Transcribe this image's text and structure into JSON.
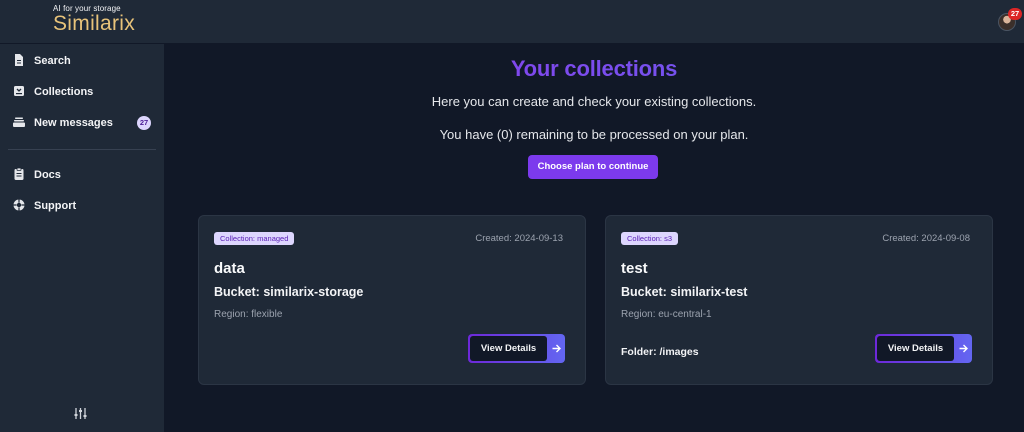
{
  "brand": {
    "tagline": "AI for your storage",
    "name": "Similarix"
  },
  "header": {
    "notification_count": "27"
  },
  "sidebar": {
    "items": [
      {
        "label": "Search",
        "icon": "document-icon"
      },
      {
        "label": "Collections",
        "icon": "inbox-icon"
      },
      {
        "label": "New messages",
        "icon": "message-stack-icon",
        "badge": "27"
      },
      {
        "label": "Docs",
        "icon": "clipboard-icon"
      },
      {
        "label": "Support",
        "icon": "lifebuoy-icon"
      }
    ],
    "footer_icon": "sliders-icon"
  },
  "main": {
    "title": "Your collections",
    "subtitle": "Here you can create and check your existing collections.",
    "remaining": "You have (0) remaining to be processed on your plan.",
    "plan_button": "Choose plan to continue"
  },
  "collections": [
    {
      "tag": "Collection: managed",
      "created": "Created: 2024-09-13",
      "name": "data",
      "bucket": "Bucket: similarix-storage",
      "region": "Region: flexible",
      "folder": "",
      "button": "View Details"
    },
    {
      "tag": "Collection: s3",
      "created": "Created: 2024-09-08",
      "name": "test",
      "bucket": "Bucket: similarix-test",
      "region": "Region: eu-central-1",
      "folder": "Folder: /images",
      "button": "View Details"
    }
  ],
  "colors": {
    "accent": "#7c3aed",
    "brand_gold": "#e8c37a",
    "background": "#111827",
    "panel": "#1f2937"
  }
}
